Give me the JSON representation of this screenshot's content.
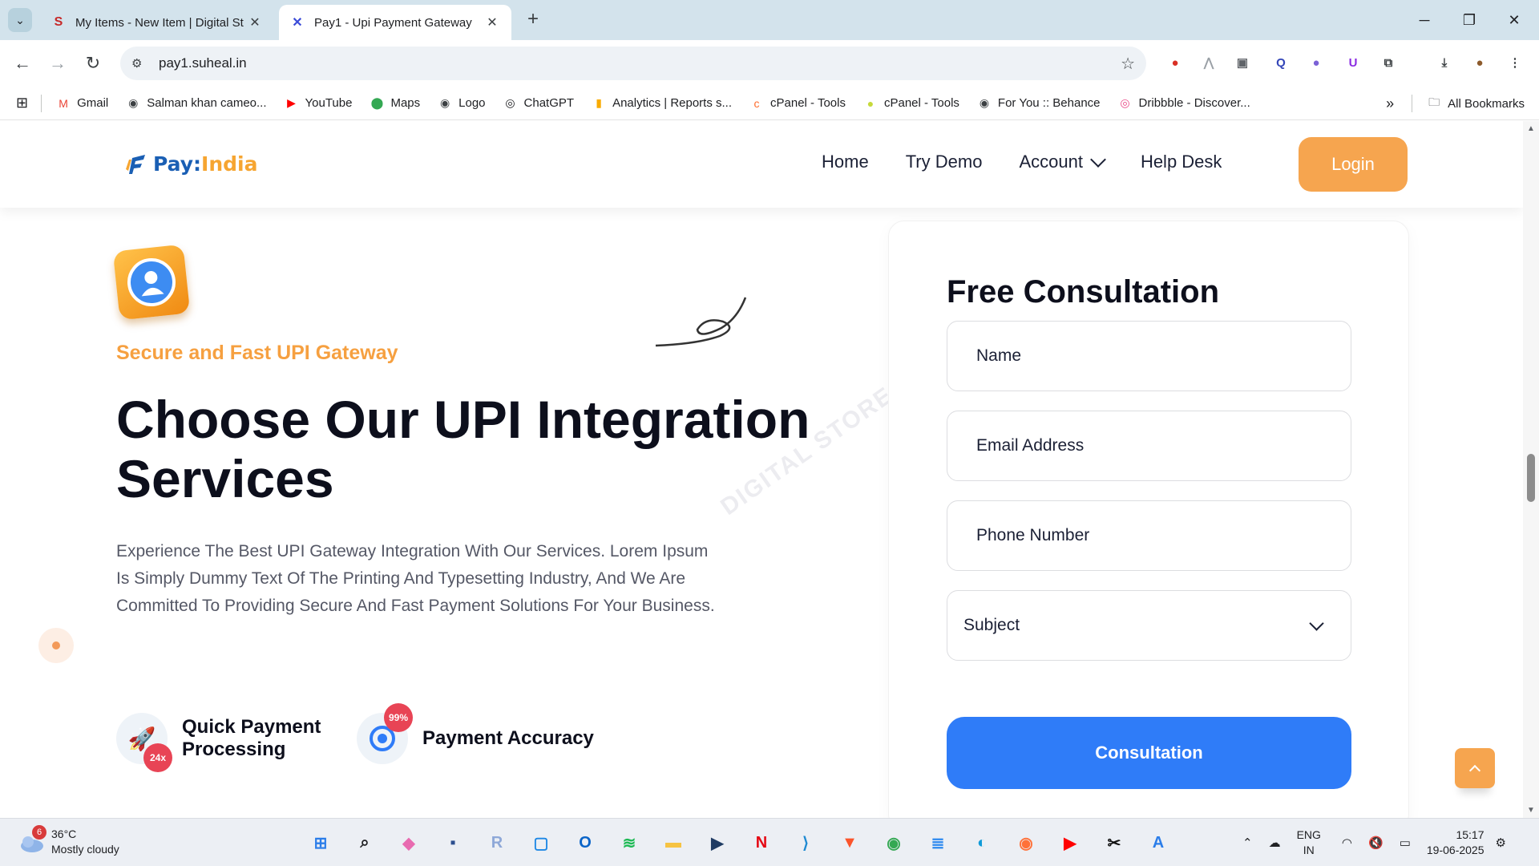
{
  "browser": {
    "tabs": [
      {
        "title": "My Items - New Item | Digital St",
        "favicon": "S",
        "favicon_color": "#c62828"
      },
      {
        "title": "Pay1 - Upi Payment Gateway",
        "favicon": "✕",
        "favicon_color": "#3b4bd8"
      }
    ],
    "new_tab": "+",
    "url": "pay1.suheal.in",
    "extensions": [
      {
        "icon": "stop-sign-icon",
        "glyph": "●",
        "color": "#d93025"
      },
      {
        "icon": "arrow-icon",
        "glyph": "⋀",
        "color": "#9aa0a6"
      },
      {
        "icon": "window-icon",
        "glyph": "▣",
        "color": "#5f6368"
      },
      {
        "icon": "search-box-icon",
        "glyph": "Q",
        "color": "#3446b8"
      },
      {
        "icon": "mascot-icon",
        "glyph": "●",
        "color": "#7b61d6"
      },
      {
        "icon": "shield-icon",
        "glyph": "U",
        "color": "#8a2be2"
      },
      {
        "icon": "puzzle-icon",
        "glyph": "⧉",
        "color": "#3c4043"
      },
      {
        "icon": "download-icon",
        "glyph": "⤓",
        "color": "#3c4043"
      },
      {
        "icon": "profile-icon",
        "glyph": "●",
        "color": "#8d5a2b"
      },
      {
        "icon": "kebab-menu-icon",
        "glyph": "⋮",
        "color": "#3c4043"
      }
    ]
  },
  "bookmarks": {
    "items": [
      {
        "label": "Gmail",
        "glyph": "M",
        "color": "#ea4335"
      },
      {
        "label": "Salman khan cameo...",
        "glyph": "◉",
        "color": "#3c4043"
      },
      {
        "label": "YouTube",
        "glyph": "▶",
        "color": "#ff0000"
      },
      {
        "label": "Maps",
        "glyph": "⬤",
        "color": "#34a853"
      },
      {
        "label": "Logo",
        "glyph": "◉",
        "color": "#3c4043"
      },
      {
        "label": "ChatGPT",
        "glyph": "◎",
        "color": "#202124"
      },
      {
        "label": "Analytics | Reports s...",
        "glyph": "▮",
        "color": "#f9ab00"
      },
      {
        "label": "cPanel - Tools",
        "glyph": "c",
        "color": "#ff6c2c"
      },
      {
        "label": "cPanel - Tools",
        "glyph": "●",
        "color": "#c6d93a"
      },
      {
        "label": "For You :: Behance",
        "glyph": "◉",
        "color": "#3c4043"
      },
      {
        "label": "Dribbble - Discover...",
        "glyph": "◎",
        "color": "#ea4c89"
      }
    ],
    "more": "»",
    "all_bookmarks": "All Bookmarks"
  },
  "site": {
    "logo_pay": "Pay:",
    "logo_india": "India",
    "nav": {
      "home": "Home",
      "try_demo": "Try Demo",
      "account": "Account",
      "help_desk": "Help Desk"
    },
    "login": "Login",
    "tagline": "Secure and Fast UPI Gateway",
    "headline": "Choose Our UPI Integration Services",
    "watermark": "DIGITAL STORE",
    "paragraph": "Experience The Best UPI Gateway Integration With Our Services. Lorem Ipsum Is Simply Dummy Text Of The Printing And Typesetting Industry, And We Are Committed To Providing Secure And Fast Payment Solutions For Your Business.",
    "features": [
      {
        "label": "Quick Payment Processing",
        "badge": "24x"
      },
      {
        "label": "Payment Accuracy",
        "badge": "99%"
      }
    ],
    "form": {
      "title": "Free Consultation",
      "name_placeholder": "Name",
      "email_placeholder": "Email Address",
      "phone_placeholder": "Phone Number",
      "subject_selected": "Subject",
      "submit": "Consultation"
    },
    "colors": {
      "accent_orange": "#f6a54f",
      "primary_blue": "#2f7cf8",
      "tagline_orange": "#f6a040"
    }
  },
  "taskbar": {
    "weather": {
      "temp": "36°C",
      "condition": "Mostly cloudy",
      "badge": "6"
    },
    "apps": [
      {
        "icon": "windows-start-icon",
        "glyph": "⊞",
        "color": "#2b7de9"
      },
      {
        "icon": "search-icon",
        "glyph": "⌕",
        "color": "#202124"
      },
      {
        "icon": "copilot-icon",
        "glyph": "◆",
        "color": "#e86bb0"
      },
      {
        "icon": "network-app-icon",
        "glyph": "▪",
        "color": "#2c4f8f"
      },
      {
        "icon": "r-app-icon",
        "glyph": "R",
        "color": "#8ea8d8"
      },
      {
        "icon": "snip-tool-icon",
        "glyph": "▢",
        "color": "#1e88e5"
      },
      {
        "icon": "outlook-icon",
        "glyph": "O",
        "color": "#0a64c8"
      },
      {
        "icon": "spotify-icon",
        "glyph": "≋",
        "color": "#1db954"
      },
      {
        "icon": "file-explorer-icon",
        "glyph": "▬",
        "color": "#f6c343"
      },
      {
        "icon": "prime-video-icon",
        "glyph": "▶",
        "color": "#1f3b63"
      },
      {
        "icon": "netflix-icon",
        "glyph": "N",
        "color": "#e50914"
      },
      {
        "icon": "vscode-icon",
        "glyph": "⟩",
        "color": "#1f8ad2"
      },
      {
        "icon": "brave-icon",
        "glyph": "▼",
        "color": "#fb542b"
      },
      {
        "icon": "chrome-icon",
        "glyph": "◉",
        "color": "#34a853"
      },
      {
        "icon": "notepad-icon",
        "glyph": "≣",
        "color": "#2d89ef"
      },
      {
        "icon": "edge-icon",
        "glyph": "◐",
        "color": "#0f9ad8"
      },
      {
        "icon": "firefox-icon",
        "glyph": "◉",
        "color": "#ff7139"
      },
      {
        "icon": "youtube-app-icon",
        "glyph": "▶",
        "color": "#ff0000"
      },
      {
        "icon": "capcut-icon",
        "glyph": "✂",
        "color": "#111111"
      },
      {
        "icon": "font-app-icon",
        "glyph": "A",
        "color": "#2b7de9"
      }
    ],
    "lang_1": "ENG",
    "lang_2": "IN",
    "time": "15:17",
    "date": "19-06-2025"
  }
}
